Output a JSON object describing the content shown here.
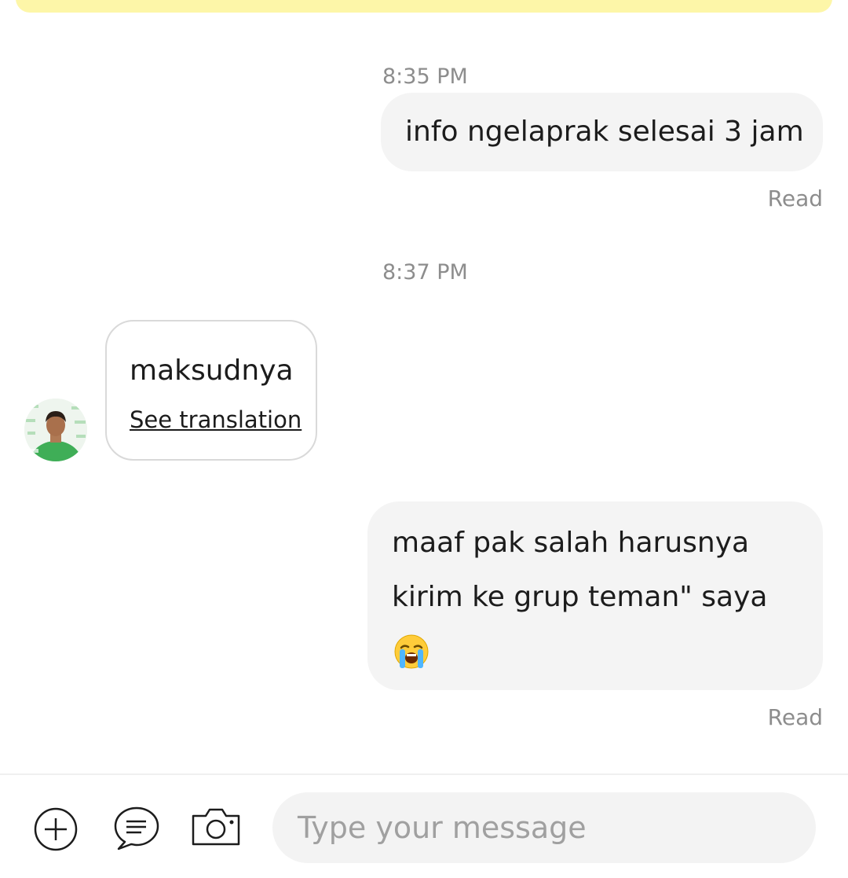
{
  "messages": [
    {
      "id": "m1",
      "direction": "outgoing",
      "timestamp": "8:35 PM",
      "text": "info ngelaprak selesai 3 jam",
      "status": "Read"
    },
    {
      "id": "m2",
      "direction": "incoming",
      "timestamp": "8:37 PM",
      "text": "maksudnya",
      "translation_link": "See translation"
    },
    {
      "id": "m3",
      "direction": "outgoing",
      "lines": [
        "maaf pak salah harusnya",
        "kirim ke grup teman\" saya"
      ],
      "emoji": "😭",
      "status": "Read"
    }
  ],
  "input_bar": {
    "placeholder": "Type your message",
    "icons": [
      "plus-circle-icon",
      "chat-bubble-icon",
      "camera-icon"
    ]
  },
  "colors": {
    "banner": "#fdf6a8",
    "bubble_out": "#f4f4f4",
    "bubble_in_border": "#d9d9d9",
    "meta_text": "#8d8d8d"
  }
}
